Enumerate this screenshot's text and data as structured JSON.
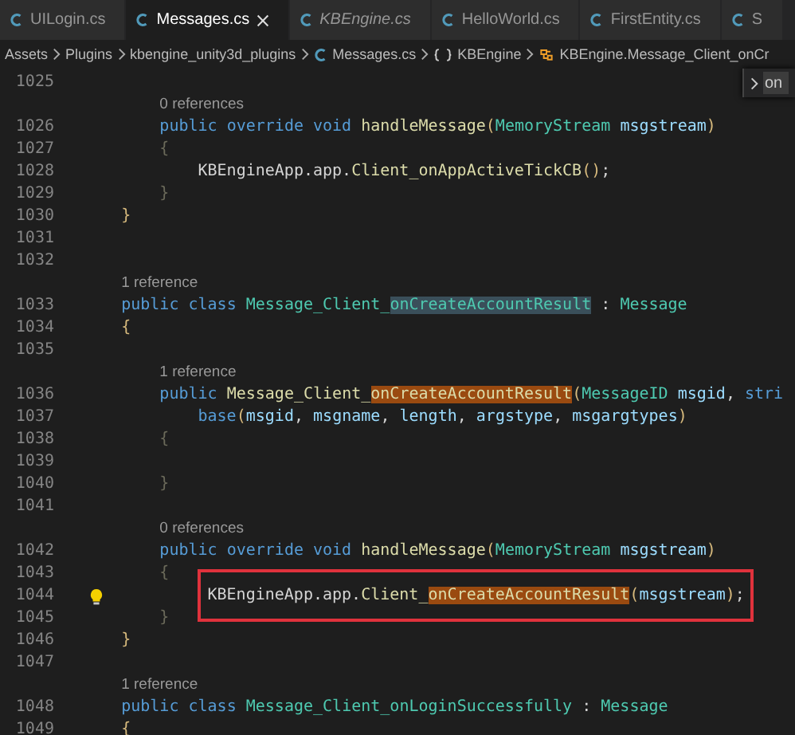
{
  "tabs": [
    {
      "label": "UILogin.cs",
      "selected": false,
      "preview": false
    },
    {
      "label": "Messages.cs",
      "selected": true,
      "preview": false
    },
    {
      "label": "KBEngine.cs",
      "selected": false,
      "preview": true
    },
    {
      "label": "HelloWorld.cs",
      "selected": false,
      "preview": false
    },
    {
      "label": "FirstEntity.cs",
      "selected": false,
      "preview": false
    },
    {
      "label": "S",
      "selected": false,
      "preview": false
    }
  ],
  "breadcrumbs": [
    {
      "label": "Assets",
      "kind": "folder"
    },
    {
      "label": "Plugins",
      "kind": "folder"
    },
    {
      "label": "kbengine_unity3d_plugins",
      "kind": "folder"
    },
    {
      "label": "Messages.cs",
      "kind": "file"
    },
    {
      "label": "KBEngine",
      "kind": "namespace"
    },
    {
      "label": "KBEngine.Message_Client_onCr",
      "kind": "class"
    }
  ],
  "find_widget": {
    "value": "on"
  },
  "editor": {
    "lines": [
      {
        "kind": "code",
        "number": "1025"
      },
      {
        "kind": "lens",
        "text": "        0 references"
      },
      {
        "kind": "code",
        "number": "1026",
        "tokens": [
          {
            "kind": "keyword",
            "text": "        public override void "
          },
          {
            "kind": "method",
            "text": "handleMessage"
          },
          {
            "kind": "bracket",
            "text": "("
          },
          {
            "kind": "type",
            "text": "MemoryStream "
          },
          {
            "kind": "variable",
            "text": "msgstream"
          },
          {
            "kind": "bracket",
            "text": ")"
          }
        ]
      },
      {
        "kind": "code",
        "number": "1027",
        "tokens": [
          {
            "kind": "dim",
            "text": "        {"
          }
        ]
      },
      {
        "kind": "code",
        "number": "1028",
        "tokens": [
          {
            "kind": "plain",
            "text": "            KBEngineApp.app."
          },
          {
            "kind": "method",
            "text": "Client_onAppActiveTickCB"
          },
          {
            "kind": "bracket",
            "text": "()"
          },
          {
            "kind": "plain",
            "text": ";"
          }
        ]
      },
      {
        "kind": "code",
        "number": "1029",
        "tokens": [
          {
            "kind": "dim",
            "text": "        }"
          }
        ]
      },
      {
        "kind": "code",
        "number": "1030",
        "tokens": [
          {
            "kind": "bracket",
            "text": "    }"
          }
        ]
      },
      {
        "kind": "code",
        "number": "1031"
      },
      {
        "kind": "code",
        "number": "1032"
      },
      {
        "kind": "lens",
        "text": "    1 reference"
      },
      {
        "kind": "code",
        "number": "1033",
        "tokens": [
          {
            "kind": "keyword",
            "text": "    public class "
          },
          {
            "kind": "type",
            "text": "Message_Client_"
          },
          {
            "kind": "type",
            "text": "onCreateAccountResult",
            "word_highlight": true
          },
          {
            "kind": "plain",
            "text": " : "
          },
          {
            "kind": "type",
            "text": "Message"
          }
        ]
      },
      {
        "kind": "code",
        "number": "1034",
        "tokens": [
          {
            "kind": "bracket",
            "text": "    {"
          }
        ]
      },
      {
        "kind": "code",
        "number": "1035"
      },
      {
        "kind": "lens",
        "text": "        1 reference"
      },
      {
        "kind": "code",
        "number": "1036",
        "tokens": [
          {
            "kind": "keyword",
            "text": "        public "
          },
          {
            "kind": "method",
            "text": "Message_Client_"
          },
          {
            "kind": "method",
            "text": "onCreateAccountResult",
            "find_match": true
          },
          {
            "kind": "bracket",
            "text": "("
          },
          {
            "kind": "type",
            "text": "MessageID "
          },
          {
            "kind": "variable",
            "text": "msgid"
          },
          {
            "kind": "plain",
            "text": ", "
          },
          {
            "kind": "keyword",
            "text": "stri"
          }
        ]
      },
      {
        "kind": "code",
        "number": "1037",
        "tokens": [
          {
            "kind": "keyword",
            "text": "            base"
          },
          {
            "kind": "bracket",
            "text": "("
          },
          {
            "kind": "variable",
            "text": "msgid"
          },
          {
            "kind": "plain",
            "text": ", "
          },
          {
            "kind": "variable",
            "text": "msgname"
          },
          {
            "kind": "plain",
            "text": ", "
          },
          {
            "kind": "variable",
            "text": "length"
          },
          {
            "kind": "plain",
            "text": ", "
          },
          {
            "kind": "variable",
            "text": "argstype"
          },
          {
            "kind": "plain",
            "text": ", "
          },
          {
            "kind": "variable",
            "text": "msgargtypes"
          },
          {
            "kind": "bracket",
            "text": ")"
          }
        ]
      },
      {
        "kind": "code",
        "number": "1038",
        "tokens": [
          {
            "kind": "dim",
            "text": "        {"
          }
        ]
      },
      {
        "kind": "code",
        "number": "1039"
      },
      {
        "kind": "code",
        "number": "1040",
        "tokens": [
          {
            "kind": "dim",
            "text": "        }"
          }
        ]
      },
      {
        "kind": "code",
        "number": "1041"
      },
      {
        "kind": "lens",
        "text": "        0 references"
      },
      {
        "kind": "code",
        "number": "1042",
        "tokens": [
          {
            "kind": "keyword",
            "text": "        public override void "
          },
          {
            "kind": "method",
            "text": "handleMessage"
          },
          {
            "kind": "bracket",
            "text": "("
          },
          {
            "kind": "type",
            "text": "MemoryStream "
          },
          {
            "kind": "variable",
            "text": "msgstream"
          },
          {
            "kind": "bracket",
            "text": ")"
          }
        ]
      },
      {
        "kind": "code",
        "number": "1043",
        "tokens": [
          {
            "kind": "dim",
            "text": "        {"
          }
        ]
      },
      {
        "kind": "code",
        "number": "1044",
        "lightbulb": true,
        "annotated": true,
        "tokens": [
          {
            "kind": "plain",
            "text": "            KBEngineApp.app."
          },
          {
            "kind": "method",
            "text": "Client_"
          },
          {
            "kind": "method",
            "text": "onCreateAccountResult",
            "find_match": true
          },
          {
            "kind": "bracket",
            "text": "("
          },
          {
            "kind": "variable",
            "text": "msgstream"
          },
          {
            "kind": "bracket",
            "text": ")"
          },
          {
            "kind": "plain",
            "text": ";"
          }
        ]
      },
      {
        "kind": "code",
        "number": "1045",
        "tokens": [
          {
            "kind": "dim",
            "text": "        }"
          }
        ]
      },
      {
        "kind": "code",
        "number": "1046",
        "tokens": [
          {
            "kind": "bracket",
            "text": "    }"
          }
        ]
      },
      {
        "kind": "code",
        "number": "1047"
      },
      {
        "kind": "lens",
        "text": "    1 reference"
      },
      {
        "kind": "code",
        "number": "1048",
        "tokens": [
          {
            "kind": "keyword",
            "text": "    public class "
          },
          {
            "kind": "type",
            "text": "Message_Client_onLoginSuccessfully"
          },
          {
            "kind": "plain",
            "text": " : "
          },
          {
            "kind": "type",
            "text": "Message"
          }
        ]
      },
      {
        "kind": "code",
        "number": "1049",
        "tokens": [
          {
            "kind": "bracket",
            "text": "    {"
          }
        ]
      }
    ]
  }
}
